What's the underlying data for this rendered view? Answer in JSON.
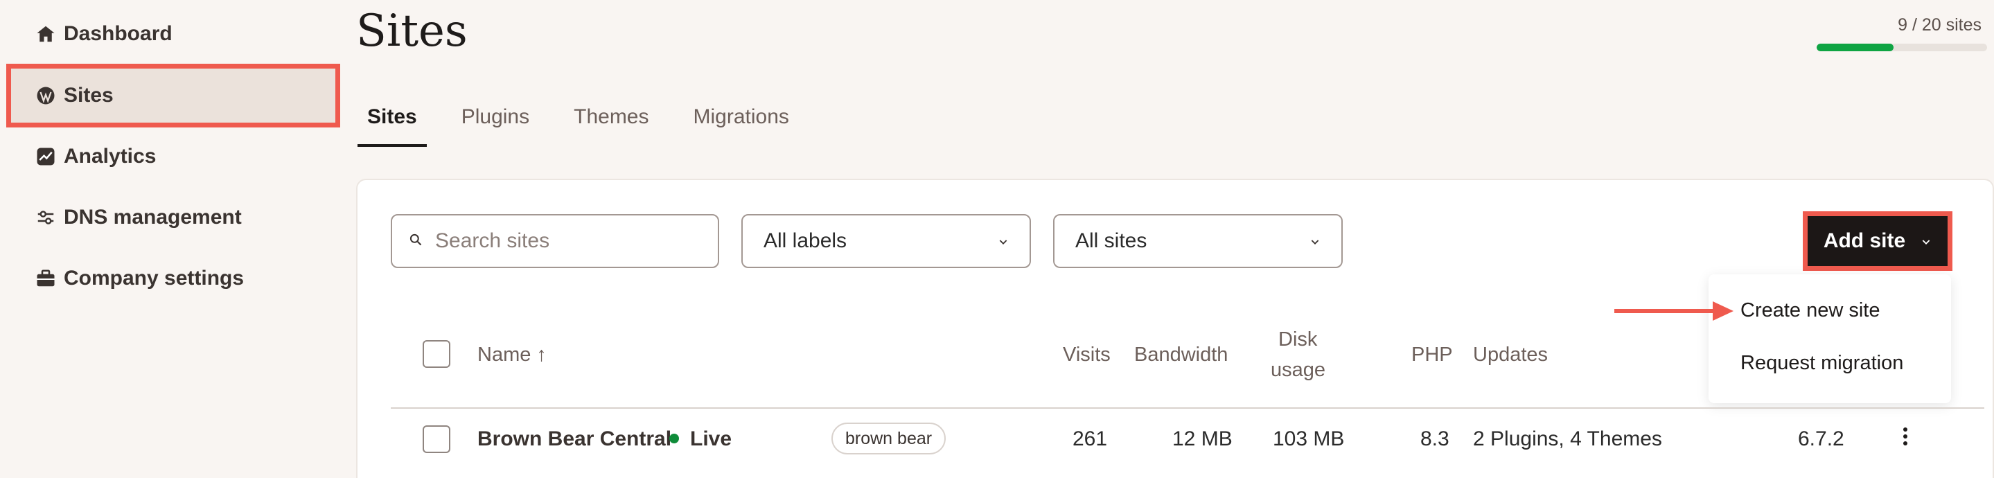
{
  "sidebar": {
    "items": [
      {
        "label": "Dashboard",
        "icon": "home-icon"
      },
      {
        "label": "Sites",
        "icon": "wordpress-icon"
      },
      {
        "label": "Analytics",
        "icon": "chart-icon"
      },
      {
        "label": "DNS management",
        "icon": "dns-icon"
      },
      {
        "label": "Company settings",
        "icon": "briefcase-icon"
      }
    ],
    "active": "Sites"
  },
  "page": {
    "title": "Sites"
  },
  "usage": {
    "text": "9 / 20 sites",
    "used": 9,
    "total": 20,
    "fill_color": "#0fa443"
  },
  "tabs": [
    {
      "label": "Sites",
      "active": true
    },
    {
      "label": "Plugins"
    },
    {
      "label": "Themes"
    },
    {
      "label": "Migrations"
    }
  ],
  "toolbar": {
    "search_placeholder": "Search sites",
    "labels_select": "All labels",
    "sites_select": "All sites",
    "add_site_label": "Add site"
  },
  "dropdown_menu": {
    "items": [
      "Create new site",
      "Request migration"
    ]
  },
  "table": {
    "headers": {
      "name": "Name ↑",
      "visits": "Visits",
      "bandwidth": "Bandwidth",
      "disk_line1": "Disk",
      "disk_line2": "usage",
      "php": "PHP",
      "updates": "Updates"
    },
    "rows": [
      {
        "name": "Brown Bear Central",
        "status": "Live",
        "label": "brown bear",
        "visits": "261",
        "bandwidth": "12 MB",
        "disk": "103 MB",
        "php": "8.3",
        "updates": "2 Plugins, 4 Themes",
        "wp_version": "6.7.2"
      }
    ]
  },
  "colors": {
    "highlight": "#ef5a4e",
    "live": "#0f8c3a",
    "button_bg": "#1c1716"
  }
}
